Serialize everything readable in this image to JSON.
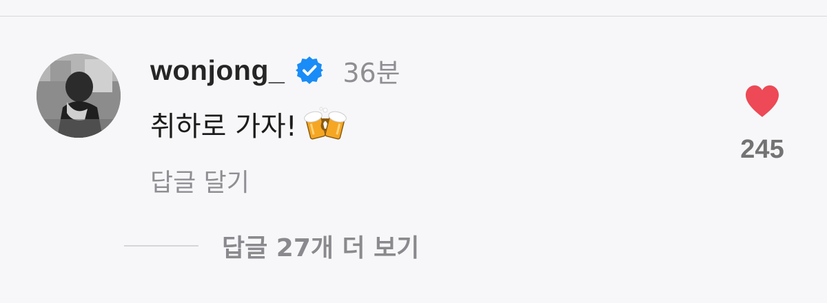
{
  "comment": {
    "username": "wonjong_",
    "verified_icon": "verified-badge-icon",
    "time_ago": "36분",
    "text": "취하로 가자!",
    "emoji_icon": "clinking-beer-mugs-icon",
    "reply_label": "답글 달기"
  },
  "like": {
    "icon": "heart-icon",
    "count": "245",
    "color": "#ed4956"
  },
  "replies": {
    "view_more_label": "답글 27개 더 보기"
  },
  "colors": {
    "verified": "#1a8cf7",
    "background": "#f7f7f9"
  }
}
